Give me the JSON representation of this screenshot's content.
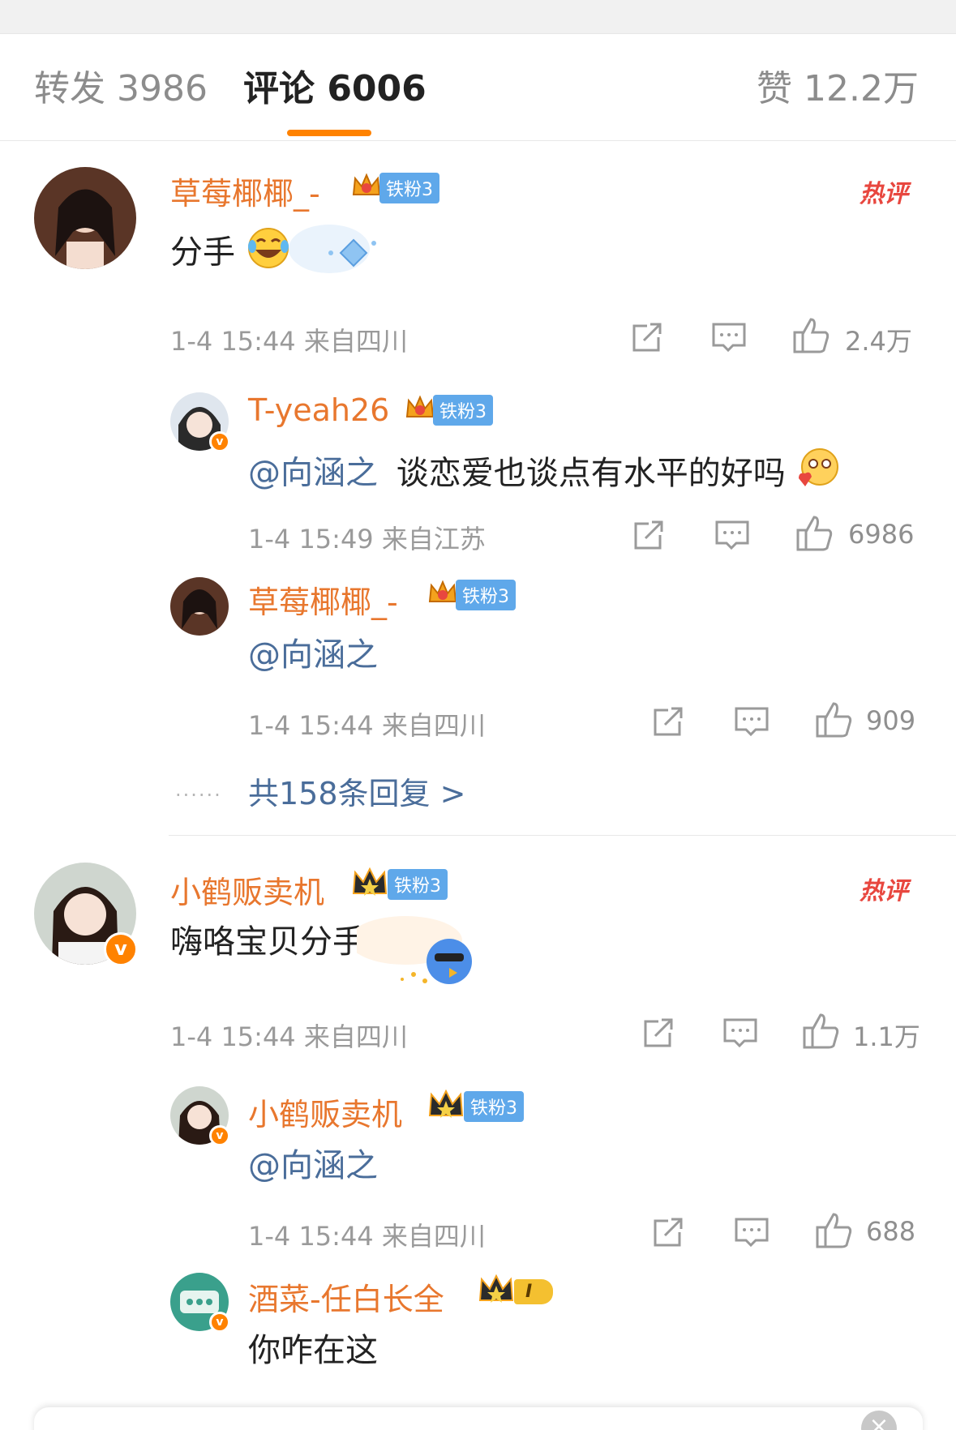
{
  "tabs": {
    "repost_label": "转发 3986",
    "comment_label": "评论 6006",
    "like_label": "赞 12.2万"
  },
  "colors": {
    "accent": "#ff8200",
    "username": "#e8772e",
    "mention": "#4a6d9a",
    "hot": "#e8473f",
    "fan_badge": "#5fa8ea"
  },
  "hot_label": "热评",
  "comments": [
    {
      "username": "草莓椰椰_-",
      "fan_badge": "铁粉3",
      "crown_level": "6",
      "text": "分手",
      "emoji": "laughing-tears-emoji",
      "time_location": "1-4 15:44  来自四川",
      "likes": "2.4万",
      "replies": [
        {
          "username": "T-yeah26",
          "fan_badge": "铁粉3",
          "crown_level": "5",
          "mention": "@向涵之",
          "text": "谈恋爱也谈点有水平的好吗",
          "emoji": "blushing-heart-emoji",
          "time_location": "1-4 15:49  来自江苏",
          "likes": "6986"
        },
        {
          "username": "草莓椰椰_-",
          "fan_badge": "铁粉3",
          "crown_level": "6",
          "mention": "@向涵之",
          "text": "",
          "time_location": "1-4 15:44  来自四川",
          "likes": "909"
        }
      ],
      "more_replies": "共158条回复 >"
    },
    {
      "username": "小鹤贩卖机",
      "fan_badge": "铁粉3",
      "text": "嗨咯宝贝分手",
      "time_location": "1-4 15:44  来自四川",
      "likes": "1.1万",
      "replies": [
        {
          "username": "小鹤贩卖机",
          "fan_badge": "铁粉3",
          "mention": "@向涵之",
          "time_location": "1-4 15:44  来自四川",
          "likes": "688"
        },
        {
          "username": "酒菜-任白长全",
          "level_badge": "I",
          "text": "你咋在这"
        }
      ]
    }
  ],
  "bottom_close": "×"
}
